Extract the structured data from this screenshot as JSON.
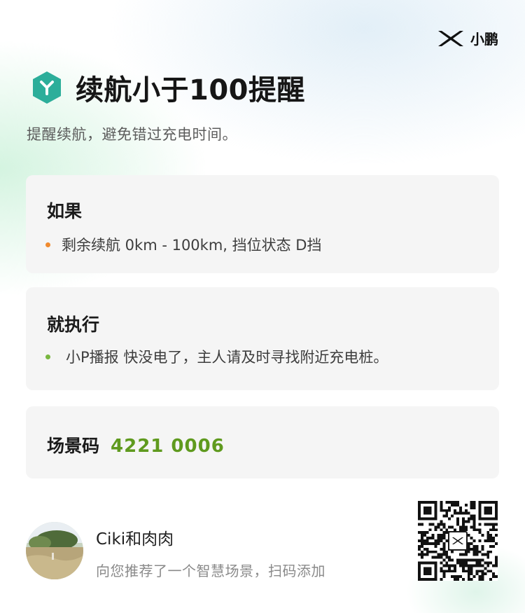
{
  "brand": {
    "name": "小鹏",
    "logo_icon": "xpeng-logo-icon"
  },
  "header": {
    "icon": "scene-hexagon-icon",
    "title": "续航小于100提醒",
    "subtitle": "提醒续航，避免错过充电时间。"
  },
  "condition": {
    "title": "如果",
    "item": "剩余续航 0km - 100km, 挡位状态 D挡"
  },
  "action": {
    "title": "就执行",
    "item": "小P播报 快没电了，主人请及时寻找附近充电桩。"
  },
  "scene_code": {
    "label": "场景码",
    "value": "4221 0006"
  },
  "share": {
    "username": "Ciki和肉肉",
    "text": "向您推荐了一个智慧场景，扫码添加"
  },
  "colors": {
    "accent_green": "#5f9a1e",
    "hex_icon": "#2cae9a",
    "dot_orange": "#f08a2e",
    "dot_green": "#79b740",
    "card_bg": "#f5f5f5"
  }
}
